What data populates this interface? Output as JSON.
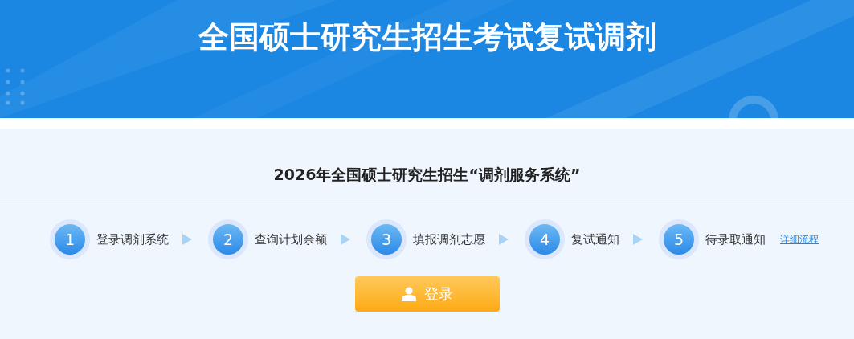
{
  "header": {
    "title": "全国硕士研究生招生考试复试调剂"
  },
  "panel": {
    "title": "2026年全国硕士研究生招生“调剂服务系统”",
    "steps": [
      {
        "number": "1",
        "label": "登录调剂系统"
      },
      {
        "number": "2",
        "label": "查询计划余额"
      },
      {
        "number": "3",
        "label": "填报调剂志愿"
      },
      {
        "number": "4",
        "label": "复试通知"
      },
      {
        "number": "5",
        "label": "待录取通知"
      }
    ],
    "details_link": "详细流程",
    "login_button": "登录"
  }
}
